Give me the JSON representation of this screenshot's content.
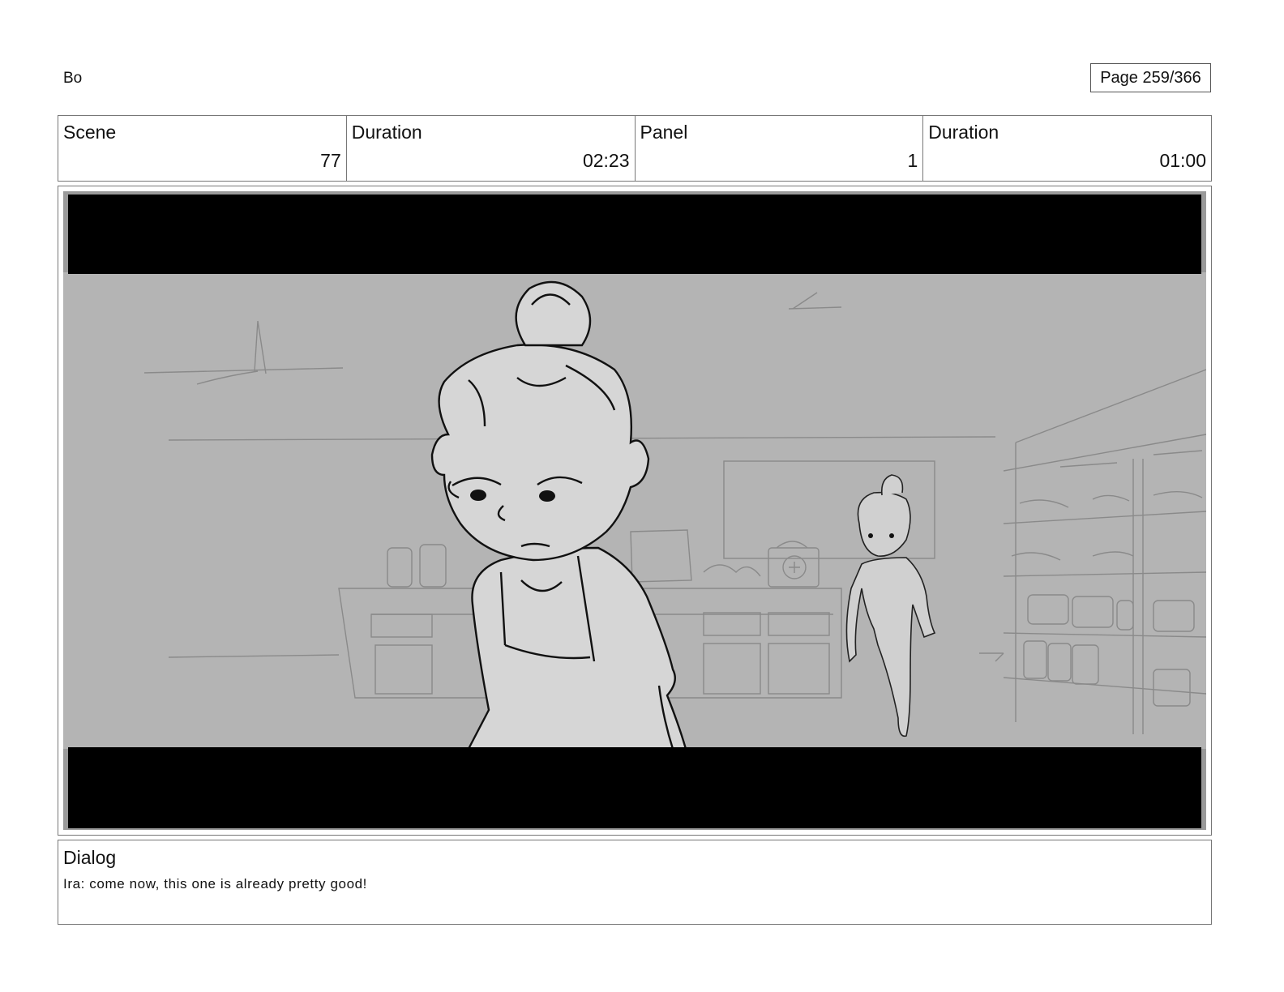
{
  "header": {
    "project_title": "Bo",
    "page_label": "Page 259/366"
  },
  "info": {
    "scene_label": "Scene",
    "scene_value": "77",
    "scene_duration_label": "Duration",
    "scene_duration_value": "02:23",
    "panel_label": "Panel",
    "panel_value": "1",
    "panel_duration_label": "Duration",
    "panel_duration_value": "01:00"
  },
  "dialog": {
    "label": "Dialog",
    "text": "Ira: come now, this one is already pretty good!"
  },
  "colors": {
    "letterbox": "#000000",
    "sketch_background": "#b4b4b4",
    "character_fill": "#d6d6d6",
    "line": "#111111"
  }
}
